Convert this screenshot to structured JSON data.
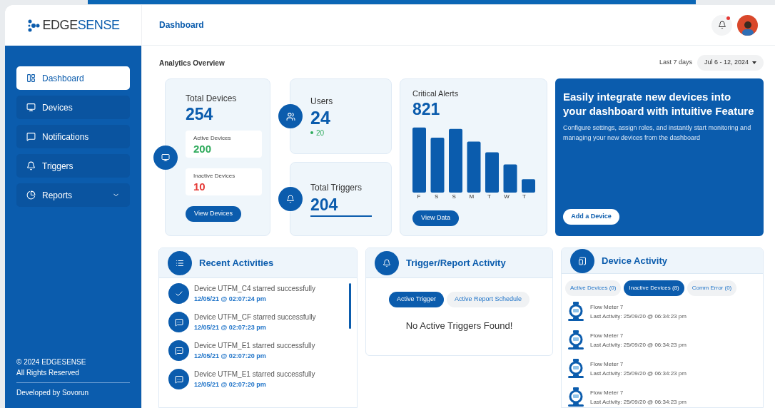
{
  "logo": {
    "brand_a": "EDGE",
    "brand_b": "SENSE"
  },
  "sidebar": {
    "items": [
      {
        "label": "Dashboard",
        "selected": true,
        "expandable": false
      },
      {
        "label": "Devices",
        "selected": false,
        "expandable": false
      },
      {
        "label": "Notifications",
        "selected": false,
        "expandable": false
      },
      {
        "label": "Triggers",
        "selected": false,
        "expandable": false
      },
      {
        "label": "Reports",
        "selected": false,
        "expandable": true
      }
    ],
    "footer": {
      "copyright": "© 2024 EDGESENSE",
      "rights": "All Rights Reserved",
      "developer": "Developed by Sovorun"
    }
  },
  "header": {
    "title": "Dashboard",
    "notifications_unread": true
  },
  "overview": {
    "title": "Analytics Overview",
    "range_label": "Last 7 days",
    "range_value": "Jul 6 - 12, 2024"
  },
  "total_devices": {
    "label": "Total Devices",
    "value": "254",
    "active": {
      "label": "Active Devices",
      "value": "200"
    },
    "inactive": {
      "label": "Inactive Devices",
      "value": "10"
    },
    "button": "View Devices"
  },
  "users": {
    "label": "Users",
    "value": "24",
    "online": "20"
  },
  "total_triggers": {
    "label": "Total Triggers",
    "value": "204"
  },
  "critical_alerts": {
    "label": "Critical Alerts",
    "value": "821",
    "days": [
      "F",
      "S",
      "S",
      "M",
      "T",
      "W",
      "T"
    ],
    "button": "View Data"
  },
  "promo": {
    "title": "Easily integrate new devices into your dashboard with intuitive Feature",
    "text": "Configure settings, assign roles, and instantly start monitoring and managing your new devices from the dashboard",
    "button": "Add a Device"
  },
  "recent_activities": {
    "title": "Recent Activities",
    "items": [
      {
        "kind": "success",
        "text": "Device UTFM_C4 starred successfully",
        "time": "12/05/21 @ 02:07:24 pm"
      },
      {
        "kind": "message",
        "text": "Device UTFM_CF starred successfully",
        "time": "12/05/21 @ 02:07:23 pm"
      },
      {
        "kind": "message",
        "text": "Device UTFM_E1 starred successfully",
        "time": "12/05/21 @ 02:07:20 pm"
      },
      {
        "kind": "message",
        "text": "Device UTFM_E1 starred successfully",
        "time": "12/05/21 @ 02:07:20 pm"
      }
    ]
  },
  "trigger_activity": {
    "title": "Trigger/Report Activity",
    "tabs": [
      {
        "label": "Active Trigger",
        "selected": true
      },
      {
        "label": "Active Report Schedule",
        "selected": false
      }
    ],
    "empty_message": "No Active Triggers Found!"
  },
  "device_activity": {
    "title": "Device Activity",
    "tabs": [
      {
        "label": "Active Devices (0)",
        "selected": false
      },
      {
        "label": "Inactive Devices (8)",
        "selected": true
      },
      {
        "label": "Comm Error (0)",
        "selected": false
      }
    ],
    "items": [
      {
        "name": "Flow Meter 7",
        "last_activity": "Last Activity: 25/09/20 @ 06:34:23 pm"
      },
      {
        "name": "Flow Meter 7",
        "last_activity": "Last Activity: 25/09/20 @ 06:34:23 pm"
      },
      {
        "name": "Flow Meter 7",
        "last_activity": "Last Activity: 25/09/20 @ 06:34:23 pm"
      },
      {
        "name": "Flow Meter 7",
        "last_activity": "Last Activity: 25/09/20 @ 06:34:23 pm"
      }
    ]
  }
}
